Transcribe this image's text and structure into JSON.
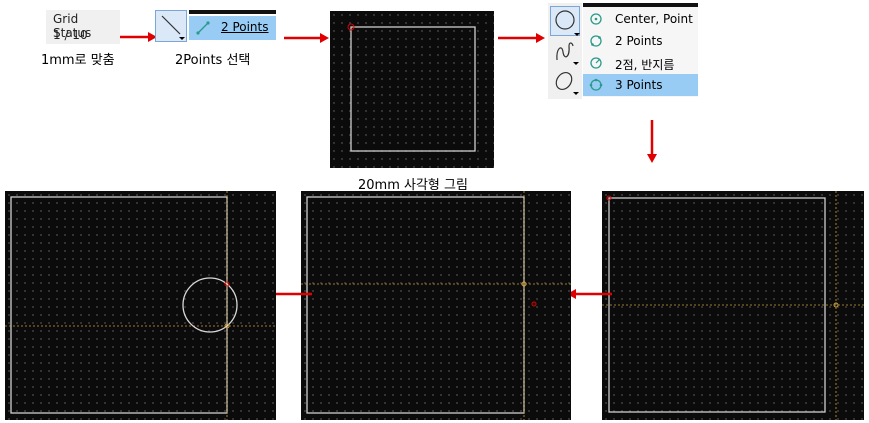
{
  "step1": {
    "grid_status_title": "Grid Status",
    "grid_status_value": "1 / 10",
    "caption": "1mm로 맞춤"
  },
  "step2": {
    "menu_item_label": "2 Points",
    "caption": "2Points 선택"
  },
  "step3": {
    "caption": "20mm 사각형 그림"
  },
  "step4": {
    "circle_menu": [
      {
        "label": "Center, Point",
        "icon": "circle-center-point-icon",
        "selected": false
      },
      {
        "label": "2 Points",
        "icon": "circle-two-points-icon",
        "selected": false
      },
      {
        "label": "2점, 반지름",
        "icon": "circle-radius-icon",
        "selected": false
      },
      {
        "label": "3 Points",
        "icon": "circle-three-points-icon",
        "selected": true
      }
    ]
  },
  "colors": {
    "arrow": "#e00000",
    "canvas_bg": "#0b0b0b",
    "shape_stroke": "#d8d8d8",
    "guide": "#c9a040",
    "menu_highlight": "#99ccf5"
  }
}
